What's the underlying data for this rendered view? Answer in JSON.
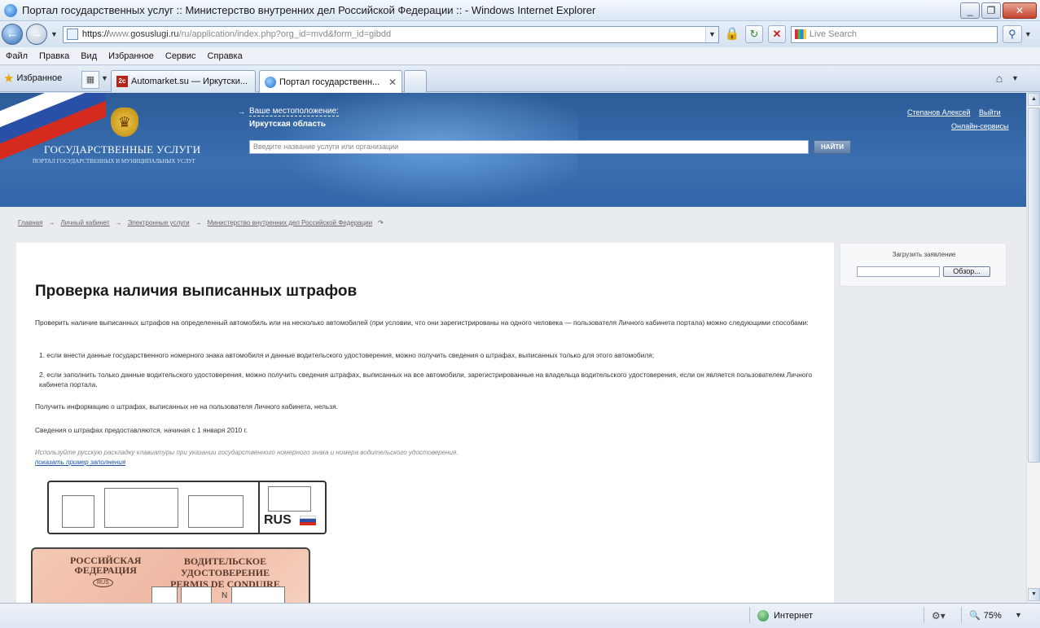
{
  "window": {
    "title": "Портал государственных услуг :: Министерство внутренних дел Российской Федерации :: - Windows Internet Explorer",
    "minimize": "_",
    "restore": "❐",
    "close": "✕"
  },
  "address": {
    "scheme": "https://",
    "host_prefix": "www.",
    "host": "gosuslugi.ru",
    "path": "/ru/application/index.php?org_id=mvd&form_id=gibdd",
    "search_placeholder": "Live Search"
  },
  "menu": [
    "Файл",
    "Правка",
    "Вид",
    "Избранное",
    "Сервис",
    "Справка"
  ],
  "toolbar": {
    "favorites_label": "Избранное"
  },
  "tabs": [
    {
      "label": "Automarket.su — Иркутски...",
      "favicon": "2c"
    },
    {
      "label": "Портал государственн...",
      "close": "✕"
    }
  ],
  "site": {
    "brand_title": "ГОСУДАРСТВЕННЫЕ УСЛУГИ",
    "brand_subtitle": "ПОРТАЛ ГОСУДАРСТВЕННЫХ И МУНИЦИПАЛЬНЫХ УСЛУГ",
    "location_label": "Ваше местоположение:",
    "location_value": "Иркутская область",
    "search_placeholder": "Введите название услуги или организации",
    "search_button": "НАЙТИ",
    "user_name": "Степанов Алексей",
    "logout": "Выйти",
    "online_services": "Онлайн-сервисы"
  },
  "breadcrumbs": [
    "Главная",
    "Личный кабинет",
    "Электронные услуги",
    "Министерство внутренних дел Российской Федерации"
  ],
  "sidebar": {
    "upload_title": "Загрузить заявление",
    "browse_button": "Обзор..."
  },
  "content": {
    "title": "Проверка наличия выписанных штрафов",
    "intro": "Проверить наличие выписанных штрафов на определенный автомобиль или на несколько автомобилей (при условии, что они зарегистрированы на одного человека — пользователя Личного кабинета портала) можно следующими способами:",
    "items": [
      "1.  если внести данные государственного номерного знака автомобиля и данные водительского удостоверения, можно получить сведения о штрафах, выписанных только для этого автомобиля;",
      "2.  если заполнить только данные водительского удостоверения, можно получить сведения штрафах, выписанных на все автомобили, зарегистрированные на владельца водительского удостоверения, если он является пользователем Личного кабинета портала."
    ],
    "note1": "Получить информацию о штрафах, выписанных не на пользователя Личного кабинета, нельзя.",
    "note2": "Сведения о штрафах предоставляются, начиная с 1 января 2010 г.",
    "hint": "Используйте русскую раскладку клавиатуры при указании государственного номерного знака и номера водительского удостоверения.",
    "sample_link": "показать пример заполнения",
    "plate_country": "RUS",
    "license_left": "РОССИЙСКАЯ\nФЕДЕРАЦИЯ",
    "license_right": "ВОДИТЕЛЬСКОЕ УДОСТОВЕРЕНИЕ\nPERMIS DE CONDUIRE",
    "license_badge": "RUS",
    "license_n": "N"
  },
  "status": {
    "zone": "Интернет",
    "zoom": "75%"
  },
  "colors": {
    "header_blue": "#3266a8",
    "link_blue": "#2254a3"
  }
}
